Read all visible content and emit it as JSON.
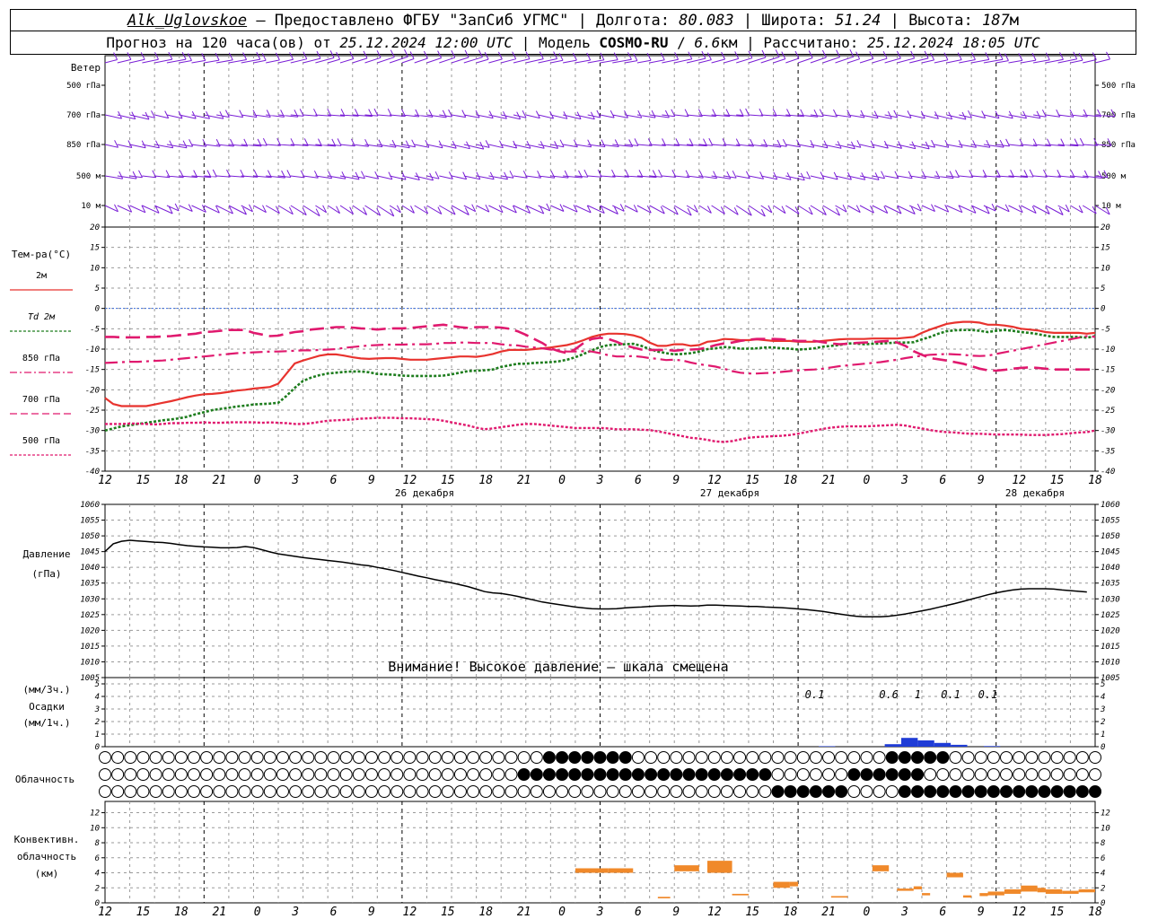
{
  "header": {
    "station": "Alk_Uglovskoe",
    "sep1": " – ",
    "provider": "Предоставлено ФГБУ \"ЗапСиб УГМС\"",
    "lon_label": " | Долгота: ",
    "lon": "80.083",
    "lat_label": " | Широта: ",
    "lat": "51.24",
    "alt_label": " | Высота: ",
    "alt": "187",
    "alt_unit": "м",
    "forecast_label": "Прогноз на 120 часа(ов) от ",
    "forecast_time": "25.12.2024 12:00 UTC",
    "model_label": " | Модель ",
    "model": "COSMO-RU",
    "model_sep": " / ",
    "model_res": "6.6",
    "model_res_unit": "км",
    "calc_label": " | Рассчитано: ",
    "calc_time": "25.12.2024 18:05 UTC"
  },
  "x_axis": {
    "hours": [
      "12",
      "15",
      "18",
      "21",
      "0",
      "3",
      "6",
      "9",
      "12",
      "15",
      "18",
      "21",
      "0",
      "3",
      "6",
      "9",
      "12",
      "15",
      "18",
      "21",
      "0",
      "3",
      "6",
      "9",
      "12",
      "15",
      "18"
    ],
    "days": [
      "26 декабря",
      "27 декабря",
      "28 декабря"
    ]
  },
  "wind": {
    "title": "Ветер",
    "levels_left": [
      "500 гПа",
      "700 гПа",
      "850 гПа",
      "500 м",
      "10 м"
    ],
    "levels_right": [
      "500 гПа",
      "700 гПа",
      "850 гПа",
      "500 м",
      "10 м"
    ],
    "color": "#7a1fd6"
  },
  "temperature": {
    "title": "Тем-ра(°C)",
    "yticks": [
      20,
      15,
      10,
      5,
      0,
      -5,
      -10,
      -15,
      -20,
      -25,
      -30,
      -35,
      -40
    ],
    "legend": [
      {
        "label": "2м",
        "color": "#e8332e"
      },
      {
        "label": "Td  2м",
        "color": "#1e7d1e"
      },
      {
        "label": "850 гПа",
        "color": "#e0196e"
      },
      {
        "label": "700 гПа",
        "color": "#e0196e"
      },
      {
        "label": "500 гПа",
        "color": "#e0196e"
      }
    ]
  },
  "pressure": {
    "title1": "Давление",
    "title2": "(гПа)",
    "yticks": [
      1060,
      1055,
      1050,
      1045,
      1040,
      1035,
      1030,
      1025,
      1020,
      1015,
      1010,
      1005
    ],
    "warning": "Внимание! Высокое давление – шкала смещена"
  },
  "precip": {
    "title1": "(мм/3ч.)",
    "title2": "Осадки",
    "title3": "(мм/1ч.)",
    "yticks": [
      5,
      4,
      3,
      2,
      1,
      0
    ],
    "labels": [
      {
        "hour": 86,
        "text": "0.1"
      },
      {
        "hour": 95,
        "text": "0.6"
      },
      {
        "hour": 98.5,
        "text": "1"
      },
      {
        "hour": 102.5,
        "text": "0.1"
      },
      {
        "hour": 107,
        "text": "0.1"
      }
    ],
    "bars": [
      {
        "h": 95.5,
        "v": 0.2
      },
      {
        "h": 97.5,
        "v": 0.7
      },
      {
        "h": 99.5,
        "v": 0.5
      },
      {
        "h": 101.5,
        "v": 0.3
      },
      {
        "h": 103.5,
        "v": 0.15
      },
      {
        "h": 107.5,
        "v": 0.05
      },
      {
        "h": 87.5,
        "v": 0.04
      }
    ],
    "color": "#1f3cd6"
  },
  "cloud": {
    "title": "Облачность"
  },
  "convective": {
    "title1": "Конвективн.",
    "title2": "облачность",
    "title3": "(км)",
    "yticks": [
      12,
      10,
      8,
      6,
      4,
      2,
      0
    ],
    "color": "#f0892a",
    "bars": [
      {
        "h0": 57,
        "h1": 61,
        "base": 4,
        "top": 4.6
      },
      {
        "h0": 61,
        "h1": 64,
        "base": 4,
        "top": 4.6
      },
      {
        "h0": 67,
        "h1": 68.5,
        "base": 0.6,
        "top": 0.8
      },
      {
        "h0": 69,
        "h1": 72,
        "base": 4.2,
        "top": 5
      },
      {
        "h0": 73,
        "h1": 76,
        "base": 4,
        "top": 5.6
      },
      {
        "h0": 76,
        "h1": 78,
        "base": 1,
        "top": 1.2
      },
      {
        "h0": 81,
        "h1": 83,
        "base": 2,
        "top": 2.8
      },
      {
        "h0": 83,
        "h1": 84,
        "base": 2.2,
        "top": 2.8
      },
      {
        "h0": 88,
        "h1": 90,
        "base": 0.7,
        "top": 0.9
      },
      {
        "h0": 93,
        "h1": 95,
        "base": 4.2,
        "top": 5
      },
      {
        "h0": 96,
        "h1": 98,
        "base": 1.6,
        "top": 1.9
      },
      {
        "h0": 98,
        "h1": 99,
        "base": 1.8,
        "top": 2.2
      },
      {
        "h0": 99,
        "h1": 100,
        "base": 1,
        "top": 1.3
      },
      {
        "h0": 102,
        "h1": 104,
        "base": 3.4,
        "top": 4
      },
      {
        "h0": 104,
        "h1": 105,
        "base": 0.7,
        "top": 1
      },
      {
        "h0": 106,
        "h1": 107,
        "base": 0.9,
        "top": 1.3
      },
      {
        "h0": 107,
        "h1": 109,
        "base": 1,
        "top": 1.5
      },
      {
        "h0": 109,
        "h1": 111,
        "base": 1.2,
        "top": 1.8
      },
      {
        "h0": 111,
        "h1": 113,
        "base": 1.5,
        "top": 2.3
      },
      {
        "h0": 113,
        "h1": 114,
        "base": 1.4,
        "top": 2
      },
      {
        "h0": 114,
        "h1": 116,
        "base": 1.2,
        "top": 1.8
      },
      {
        "h0": 116,
        "h1": 118,
        "base": 1.2,
        "top": 1.6
      },
      {
        "h0": 118,
        "h1": 120,
        "base": 1.4,
        "top": 1.8
      }
    ]
  },
  "chart_data": {
    "type": "line",
    "x_hours_from_start": [
      0,
      1,
      2,
      3,
      4,
      5,
      6,
      7,
      8,
      9,
      10,
      11,
      12,
      13,
      14,
      15,
      16,
      17,
      18,
      19,
      20,
      21,
      22,
      23,
      24,
      25,
      26,
      27,
      28,
      29,
      30,
      31,
      32,
      33,
      34,
      35,
      36,
      37,
      38,
      39,
      40,
      41,
      42,
      43,
      44,
      45,
      46,
      47,
      48,
      49,
      50,
      51,
      52,
      53,
      54,
      55,
      56,
      57,
      58,
      59,
      60,
      61,
      62,
      63,
      64,
      65,
      66,
      67,
      68,
      69,
      70,
      71,
      72,
      73,
      74,
      75,
      76,
      77,
      78,
      79,
      80,
      81,
      82,
      83,
      84,
      85,
      86,
      87,
      88,
      89,
      90,
      91,
      92,
      93,
      94,
      95,
      96,
      97,
      98,
      99,
      100,
      101,
      102,
      103,
      104,
      105,
      106,
      107,
      108,
      109,
      110,
      111,
      112,
      113,
      114,
      115,
      116,
      117,
      118,
      119,
      120
    ],
    "temperature_series": [
      {
        "name": "2м",
        "values": [
          -22,
          -23.5,
          -24,
          -24,
          -24,
          -24,
          -23.6,
          -23.2,
          -22.8,
          -22.3,
          -21.8,
          -21.4,
          -21.1,
          -21,
          -20.8,
          -20.5,
          -20.2,
          -20,
          -19.7,
          -19.5,
          -19.3,
          -18.5,
          -16,
          -13.5,
          -12.8,
          -12.2,
          -11.6,
          -11.3,
          -11.3,
          -11.6,
          -12,
          -12.3,
          -12.4,
          -12.3,
          -12.2,
          -12.2,
          -12.4,
          -12.6,
          -12.6,
          -12.6,
          -12.4,
          -12.2,
          -12,
          -11.8,
          -11.8,
          -11.9,
          -11.6,
          -11.2,
          -10.6,
          -10.2,
          -10.2,
          -10.2,
          -10,
          -9.8,
          -9.6,
          -9.3,
          -9,
          -8.5,
          -7.8,
          -7,
          -6.5,
          -6.2,
          -6.2,
          -6.3,
          -6.6,
          -7.2,
          -8.4,
          -9.2,
          -9.2,
          -8.8,
          -8.8,
          -9.2,
          -9,
          -8.2,
          -8,
          -7.5,
          -7.6,
          -7.8,
          -7.8,
          -7.6,
          -7.8,
          -8,
          -8,
          -8,
          -8.2,
          -8.2,
          -8.2,
          -8,
          -7.8,
          -7.6,
          -7.5,
          -7.5,
          -7.5,
          -7.4,
          -7.4,
          -7.4,
          -7.4,
          -7.2,
          -7,
          -6,
          -5.2,
          -4.5,
          -3.8,
          -3.5,
          -3.3,
          -3.3,
          -3.5,
          -4,
          -4,
          -4.2,
          -4.5,
          -5,
          -5.2,
          -5.4,
          -5.8,
          -6,
          -6,
          -6,
          -6,
          -6.2,
          -6
        ]
      },
      {
        "name": "Td 2м",
        "values": [
          -30,
          -29.5,
          -29,
          -28.7,
          -28.4,
          -28.1,
          -27.8,
          -27.5,
          -27.3,
          -27,
          -26.6,
          -26,
          -25.5,
          -25,
          -24.7,
          -24.4,
          -24.1,
          -23.9,
          -23.6,
          -23.5,
          -23.4,
          -23.2,
          -21.5,
          -19.5,
          -17.8,
          -17,
          -16.4,
          -16,
          -15.8,
          -15.6,
          -15.5,
          -15.5,
          -15.7,
          -16.1,
          -16.2,
          -16.3,
          -16.5,
          -16.6,
          -16.6,
          -16.6,
          -16.6,
          -16.5,
          -16.2,
          -15.8,
          -15.4,
          -15.3,
          -15.2,
          -15,
          -14.4,
          -14,
          -13.6,
          -13.6,
          -13.4,
          -13.3,
          -13.2,
          -13,
          -12.6,
          -12,
          -11.2,
          -10.3,
          -9.5,
          -9,
          -8.9,
          -8.8,
          -8.7,
          -9.2,
          -10,
          -10.6,
          -11,
          -11.3,
          -11.2,
          -11,
          -10.6,
          -10,
          -9.8,
          -9.5,
          -9.6,
          -9.9,
          -9.9,
          -9.8,
          -9.6,
          -9.6,
          -9.8,
          -9.9,
          -10.1,
          -10,
          -9.8,
          -9.4,
          -9.2,
          -9,
          -8.6,
          -8.6,
          -8.8,
          -8.7,
          -8.6,
          -8.5,
          -8.4,
          -8.4,
          -8.3,
          -7.6,
          -7,
          -6.2,
          -5.6,
          -5.4,
          -5.3,
          -5.3,
          -5.5,
          -5.8,
          -5.5,
          -5.3,
          -5.5,
          -5.8,
          -6,
          -6.3,
          -6.7,
          -7,
          -7,
          -7,
          -7,
          -7.2,
          -6.8
        ]
      },
      {
        "name": "850 гПа",
        "values": [
          -13.4,
          -13.3,
          -13.2,
          -13.1,
          -13.1,
          -13,
          -12.9,
          -12.8,
          -12.6,
          -12.4,
          -12.2,
          -12,
          -11.8,
          -11.6,
          -11.4,
          -11.2,
          -11,
          -10.9,
          -10.8,
          -10.7,
          -10.6,
          -10.6,
          -10.5,
          -10.4,
          -10.3,
          -10.3,
          -10.2,
          -10.1,
          -10,
          -9.7,
          -9.5,
          -9.3,
          -9.1,
          -9,
          -8.9,
          -8.9,
          -8.9,
          -8.8,
          -8.8,
          -8.8,
          -8.7,
          -8.5,
          -8.5,
          -8.4,
          -8.4,
          -8.5,
          -8.5,
          -8.5,
          -8.8,
          -9,
          -9.1,
          -9.4,
          -9.6,
          -9.8,
          -10.1,
          -10.3,
          -10.6,
          -10.6,
          -10.5,
          -10.6,
          -11,
          -11.5,
          -11.8,
          -11.8,
          -11.7,
          -11.9,
          -12.2,
          -12.4,
          -12.7,
          -12.6,
          -12.8,
          -13.3,
          -13.7,
          -14,
          -14.3,
          -14.8,
          -15.4,
          -15.8,
          -16,
          -16,
          -15.9,
          -15.8,
          -15.6,
          -15.4,
          -15.2,
          -15.1,
          -15,
          -14.8,
          -14.5,
          -14.2,
          -14,
          -13.8,
          -13.6,
          -13.4,
          -13.2,
          -12.9,
          -12.6,
          -12.2,
          -11.9,
          -11.6,
          -11.4,
          -11.3,
          -11.2,
          -11.3,
          -11.4,
          -11.6,
          -11.7,
          -11.6,
          -11.2,
          -10.8,
          -10.4,
          -10,
          -9.6,
          -9.2,
          -8.8,
          -8.4,
          -8,
          -7.6,
          -7.2,
          -6.8,
          -7
        ]
      },
      {
        "name": "700 гПа",
        "values": [
          -7,
          -7,
          -7.1,
          -7.1,
          -7.1,
          -7,
          -7,
          -6.9,
          -6.8,
          -6.6,
          -6.4,
          -6.2,
          -5.8,
          -5.7,
          -5.5,
          -5.3,
          -5.3,
          -5.3,
          -6,
          -6.4,
          -6.8,
          -6.7,
          -6.2,
          -5.8,
          -5.6,
          -5.2,
          -5,
          -4.8,
          -4.6,
          -4.6,
          -4.7,
          -4.9,
          -5,
          -5.2,
          -5,
          -4.9,
          -4.9,
          -4.8,
          -4.6,
          -4.4,
          -4.2,
          -4,
          -4.3,
          -4.6,
          -4.8,
          -4.6,
          -4.6,
          -4.6,
          -4.7,
          -5,
          -5.6,
          -6.5,
          -7.5,
          -8.5,
          -9.8,
          -10.5,
          -11,
          -10,
          -8.5,
          -7.5,
          -7.2,
          -7.5,
          -8.2,
          -9.1,
          -9.6,
          -10.1,
          -10.2,
          -10.2,
          -10.2,
          -10.4,
          -10.2,
          -10.1,
          -10,
          -9.6,
          -9,
          -8.6,
          -8.4,
          -8,
          -7.7,
          -7.5,
          -7.5,
          -7.5,
          -7.6,
          -7.8,
          -8,
          -8,
          -8,
          -8.3,
          -8.6,
          -8.8,
          -8.7,
          -8.5,
          -8.4,
          -8.3,
          -8.1,
          -8,
          -8.4,
          -9.2,
          -10.5,
          -11.4,
          -12.2,
          -12.5,
          -12.8,
          -13.2,
          -13.6,
          -14.2,
          -14.8,
          -15.2,
          -15.3,
          -15.1,
          -14.8,
          -14.6,
          -14.5,
          -14.6,
          -14.8,
          -15,
          -15,
          -15,
          -15,
          -15,
          -15
        ]
      },
      {
        "name": "500 гПа",
        "values": [
          -28.4,
          -28.4,
          -28.4,
          -28.3,
          -28.3,
          -28.4,
          -28.5,
          -28.4,
          -28.2,
          -28.2,
          -28.1,
          -28.1,
          -28,
          -28.1,
          -28.1,
          -28,
          -28,
          -28,
          -28,
          -28.1,
          -28,
          -28.1,
          -28.2,
          -28.4,
          -28.4,
          -28.2,
          -27.9,
          -27.6,
          -27.5,
          -27.4,
          -27.3,
          -27.1,
          -27,
          -26.9,
          -26.9,
          -26.9,
          -27,
          -27,
          -27.1,
          -27.2,
          -27.3,
          -27.6,
          -28,
          -28.4,
          -28.8,
          -29.3,
          -29.7,
          -29.5,
          -29.2,
          -28.9,
          -28.6,
          -28.4,
          -28.4,
          -28.6,
          -28.8,
          -29,
          -29.2,
          -29.4,
          -29.4,
          -29.4,
          -29.4,
          -29.5,
          -29.7,
          -29.7,
          -29.7,
          -29.8,
          -29.9,
          -30.2,
          -30.6,
          -31,
          -31.4,
          -31.8,
          -32,
          -32.3,
          -32.7,
          -32.8,
          -32.6,
          -32.2,
          -31.8,
          -31.6,
          -31.5,
          -31.4,
          -31.3,
          -31.1,
          -30.8,
          -30.4,
          -30,
          -29.6,
          -29.3,
          -29.1,
          -29,
          -29,
          -29,
          -28.9,
          -28.8,
          -28.7,
          -28.6,
          -28.8,
          -29.2,
          -29.5,
          -29.9,
          -30.2,
          -30.4,
          -30.5,
          -30.7,
          -30.8,
          -30.8,
          -30.9,
          -31,
          -31,
          -31,
          -31,
          -31.1,
          -31.1,
          -31.1,
          -31,
          -30.9,
          -30.7,
          -30.5,
          -30.4,
          -30
        ]
      }
    ],
    "pressure_values": [
      1045,
      1047.5,
      1048.3,
      1048.6,
      1048.4,
      1048.2,
      1048,
      1047.9,
      1047.6,
      1047.2,
      1046.9,
      1046.7,
      1046.5,
      1046.4,
      1046.2,
      1046.2,
      1046.3,
      1046.6,
      1046.3,
      1045.6,
      1044.9,
      1044.3,
      1043.9,
      1043.5,
      1043.1,
      1042.8,
      1042.5,
      1042.2,
      1041.9,
      1041.6,
      1041.2,
      1040.8,
      1040.5,
      1040,
      1039.5,
      1039,
      1038.4,
      1037.8,
      1037.2,
      1036.7,
      1036.1,
      1035.6,
      1035.1,
      1034.5,
      1033.9,
      1033.1,
      1032.3,
      1031.9,
      1031.7,
      1031.3,
      1030.8,
      1030.2,
      1029.6,
      1029,
      1028.6,
      1028.2,
      1027.8,
      1027.4,
      1027.1,
      1026.9,
      1026.8,
      1026.8,
      1026.9,
      1027.1,
      1027.3,
      1027.4,
      1027.6,
      1027.7,
      1027.8,
      1027.9,
      1027.8,
      1027.7,
      1027.8,
      1028,
      1028,
      1027.9,
      1027.8,
      1027.7,
      1027.6,
      1027.6,
      1027.4,
      1027.3,
      1027.2,
      1027,
      1026.8,
      1026.6,
      1026.3,
      1026,
      1025.6,
      1025.2,
      1024.8,
      1024.5,
      1024.3,
      1024.3,
      1024.3,
      1024.5,
      1024.8,
      1025.2,
      1025.7,
      1026.2,
      1026.7,
      1027.3,
      1027.9,
      1028.5,
      1029.2,
      1029.9,
      1030.6,
      1031.3,
      1031.9,
      1032.4,
      1032.8,
      1033.1,
      1033.2,
      1033.2,
      1033.2,
      1033.1,
      1032.8,
      1032.6,
      1032.4,
      1032.2
    ],
    "temperature_ylim": [
      -40,
      20
    ],
    "pressure_ylim": [
      1005,
      1060
    ]
  }
}
